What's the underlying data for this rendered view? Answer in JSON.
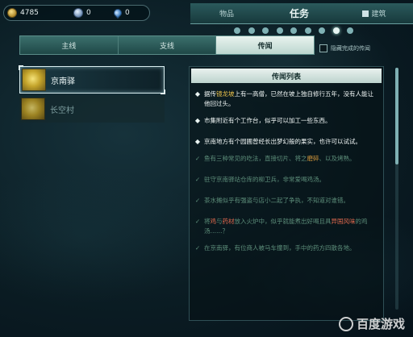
{
  "currency": {
    "coins": "4785",
    "orbs": "0",
    "drops": "0"
  },
  "top_tabs": {
    "items": "物品",
    "quests": "任务",
    "buildings": "建筑"
  },
  "sub_tabs": {
    "main": "主线",
    "side": "支线",
    "rumors": "传闻"
  },
  "hide_completed_label": "隐藏完成的传闻",
  "quest_list": [
    {
      "label": "京南驿",
      "selected": true
    },
    {
      "label": "长空村",
      "selected": false
    }
  ],
  "panel": {
    "title": "传闻列表",
    "entries": [
      {
        "pre": "据传",
        "hl": "镜龙坡",
        "post": "上有一高僧，已然在坡上独自修行五年，没有人能让他回过头。",
        "status": "new"
      },
      {
        "pre": "市集附近有个工作台，似乎可以加工一些东西。",
        "hl": "",
        "post": "",
        "status": "new"
      },
      {
        "pre": "京南地方有个园圃曾经长出梦幻般的果实，也许可以试试。",
        "hl": "",
        "post": "",
        "status": "new"
      },
      {
        "pre": "鱼有三种常见的吃法，直接切片、将之",
        "hl": "磨碎",
        "post": "、以及烤熟。",
        "status": "done"
      },
      {
        "pre": "驻守京南驿站仓库的柳卫兵，非常爱喝鸡汤。",
        "hl": "",
        "post": "",
        "status": "done"
      },
      {
        "pre": "茶水摊似乎有强盗与店小二起了争执，不知道对谁错。",
        "hl": "",
        "post": "",
        "status": "done"
      },
      {
        "pre": "将",
        "hl": "鸡",
        "mid": "与",
        "hl2": "药材",
        "mid2": "放入火炉中，似乎就能煮出好喝且具",
        "hl3": "异国风味",
        "post": "的鸡汤……？",
        "status": "done"
      },
      {
        "pre": "在京南驿，有位商人被马车撞到，手中的药方四散各地。",
        "hl": "",
        "post": "",
        "status": "done"
      }
    ]
  },
  "watermark": "百度游戏"
}
